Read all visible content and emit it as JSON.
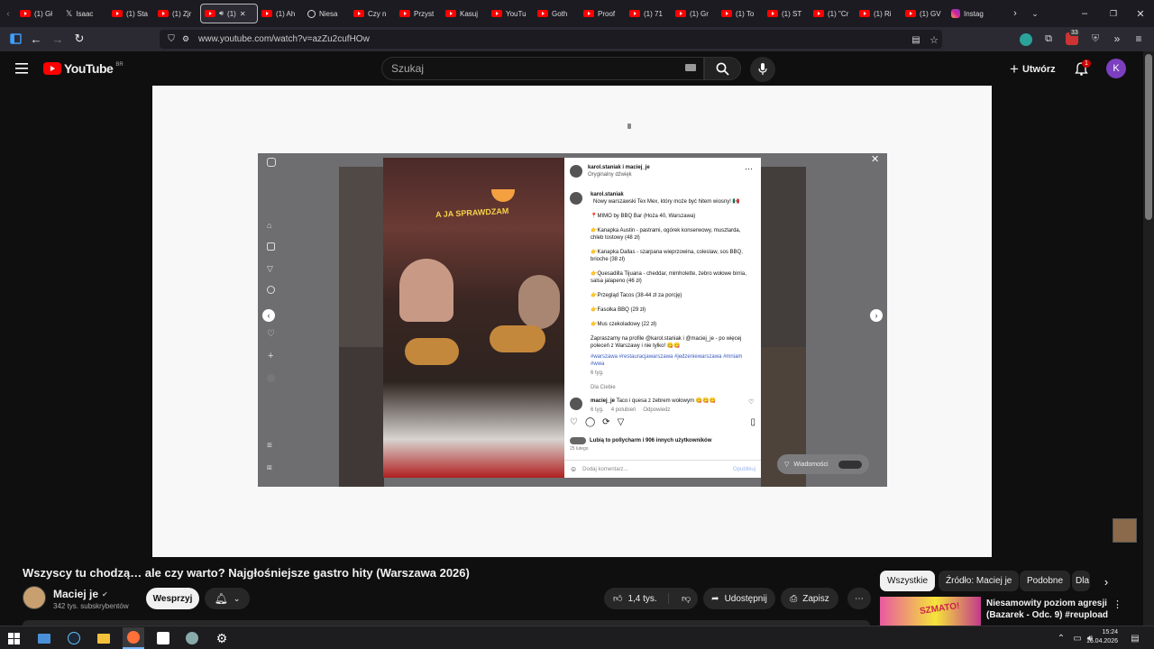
{
  "browser": {
    "tabs": [
      {
        "label": "(1) Gł",
        "icon": "youtube-icon"
      },
      {
        "label": "Isaac",
        "icon": "x-icon"
      },
      {
        "label": "(1) Sta",
        "icon": "youtube-icon"
      },
      {
        "label": "(1) Zjr",
        "icon": "youtube-icon"
      },
      {
        "label": "(1)",
        "icon": "youtube-icon",
        "active": true
      },
      {
        "label": "(1) Ah",
        "icon": "youtube-icon"
      },
      {
        "label": "Niesa",
        "icon": "globe-icon"
      },
      {
        "label": "Czy n",
        "icon": "youtube-icon"
      },
      {
        "label": "Przyst",
        "icon": "youtube-icon"
      },
      {
        "label": "Kasuj",
        "icon": "youtube-icon"
      },
      {
        "label": "YouTu",
        "icon": "youtube-icon"
      },
      {
        "label": "Goth",
        "icon": "youtube-icon"
      },
      {
        "label": "Proof",
        "icon": "youtube-icon"
      },
      {
        "label": "(1) 71",
        "icon": "youtube-icon"
      },
      {
        "label": "(1) Gr",
        "icon": "youtube-icon"
      },
      {
        "label": "(1) To",
        "icon": "youtube-icon"
      },
      {
        "label": "(1) ST",
        "icon": "youtube-icon"
      },
      {
        "label": "(1) \"Cr",
        "icon": "youtube-icon"
      },
      {
        "label": "(1) Ri",
        "icon": "youtube-icon"
      },
      {
        "label": "(1) GV",
        "icon": "youtube-icon"
      },
      {
        "label": "Instag",
        "icon": "instagram-icon"
      }
    ],
    "url": "www.youtube.com/watch?v=azZu2cufHOw",
    "extension_badge": "33"
  },
  "youtube": {
    "logo_text": "YouTube",
    "logo_region": "BR",
    "search_placeholder": "Szukaj",
    "create_label": "Utwórz",
    "notification_count": "1",
    "avatar_letter": "K"
  },
  "video": {
    "overlay_caption": "A JA SPRAWDZAM",
    "instagram": {
      "author_line": "karol.staniak i maciej_je",
      "audio": "Oryginalny dźwięk",
      "caption_author": "karol.staniak",
      "caption_lines": [
        "Nowy warszawski Tex Mex, który może być hitem wiosny! 🇲🇽",
        "📍MIMO by BBQ Bar (Hoża 40, Warszawa)",
        "👉Kanapka Austin - pastrami, ogórek konserwowy, musztarda, chleb tostowy (48 zł)",
        "👉Kanapka Dallas - szarpana wieprzowina, coleslaw, sos BBQ, brioche (38 zł)",
        "👉Quesadilla Tijuana - cheddar, mimholette, żebro wołowe birria, salsa jalapeno (46 zł)",
        "👉Przegląd Tacos (38-44 zł za porcję)",
        "👉Fasolka BBQ (29 zł)",
        "👉Mus czekoladowy (22 zł)",
        "Zapraszamy na profile @karol.staniak i @maciej_je - po więcej poleceń z Warszawy i nie tylko! 😋😋"
      ],
      "hashtags": "#warszawa #restauracjawarszawa #jedzeniewarszawa #mniam #wwa",
      "caption_time": "6 tyg.",
      "for_you": "Dla Ciebie",
      "comment_author": "maciej_je",
      "comment_text": "Taco i quesa z żebrem wołowym 😋😋😋",
      "comment_time": "6 tyg.",
      "comment_likes": "4 polubień",
      "comment_reply": "Odpowiedz",
      "likes_text": "Lubią to pollycharm i 906 innych użytkowników",
      "post_date": "25 lutego",
      "add_comment": "Dodaj komentarz...",
      "publish": "Opublikuj",
      "messages": "Wiadomości"
    }
  },
  "watch": {
    "title": "Wszyscy tu chodzą… ale czy warto? Najgłośniejsze gastro hity (Warszawa 2026)",
    "channel_name": "Maciej je",
    "subscribers": "342 tys. subskrybentów",
    "support_label": "Wesprzyj",
    "likes": "1,4 tys.",
    "share_label": "Udostępnij",
    "save_label": "Zapisz",
    "chips": [
      "Wszystkie",
      "Źródło: Maciej je",
      "Podobne",
      "Dla"
    ],
    "rec_title": "Niesamowity poziom agresji (Bazarek - Odc. 9) #reupload",
    "rec_thumb_text": "SZMATO!"
  },
  "taskbar": {
    "time": "15:24",
    "date": "16.04.2026"
  }
}
